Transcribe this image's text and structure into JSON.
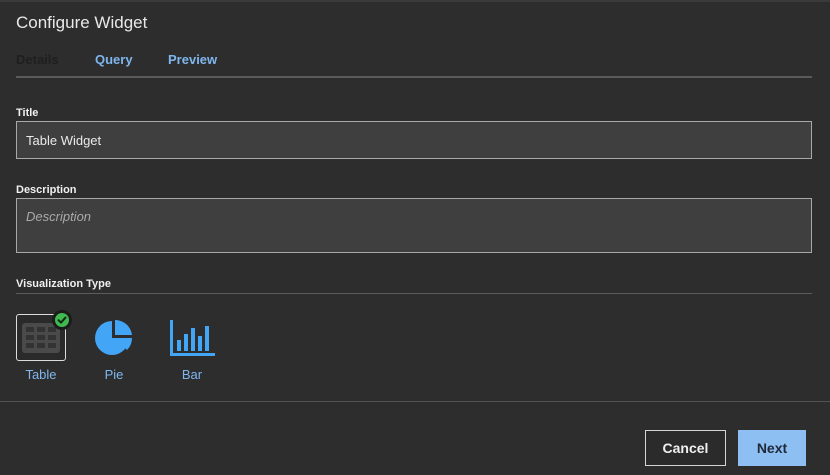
{
  "dialog": {
    "title": "Configure Widget"
  },
  "tabs": [
    {
      "label": "Details"
    },
    {
      "label": "Query"
    },
    {
      "label": "Preview"
    }
  ],
  "form": {
    "title_label": "Title",
    "title_value": "Table Widget",
    "description_label": "Description",
    "description_placeholder": "Description",
    "description_value": ""
  },
  "visualization": {
    "label": "Visualization Type",
    "options": [
      {
        "label": "Table",
        "icon": "table-icon",
        "selected": true
      },
      {
        "label": "Pie",
        "icon": "pie-chart-icon",
        "selected": false
      },
      {
        "label": "Bar",
        "icon": "bar-chart-icon",
        "selected": false
      }
    ]
  },
  "footer": {
    "cancel_label": "Cancel",
    "next_label": "Next"
  },
  "colors": {
    "background": "#2d2d2d",
    "accent": "#7fb6ee",
    "primary_button": "#8ebff2",
    "selected_check": "#3fb950",
    "icon_blue": "#42a5f5"
  }
}
